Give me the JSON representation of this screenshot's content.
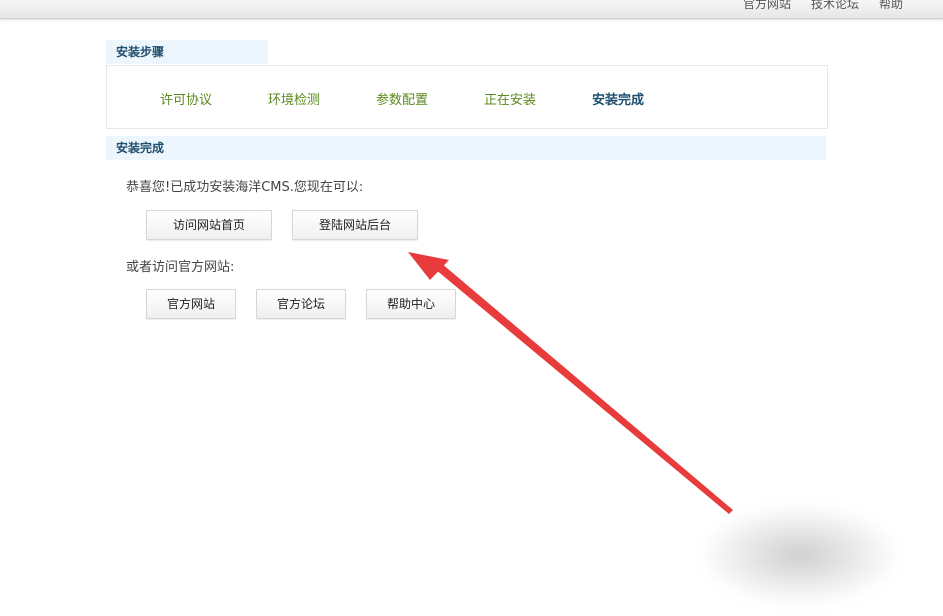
{
  "top_links": [
    "官方网站",
    "技术论坛",
    "帮助"
  ],
  "install_steps": {
    "title": "安装步骤",
    "steps": [
      "许可协议",
      "环境检测",
      "参数配置",
      "正在安装",
      "安装完成"
    ],
    "current_index": 4
  },
  "complete_section": {
    "title": "安装完成",
    "message": "恭喜您!已成功安装海洋CMS.您现在可以:",
    "buttons": [
      "访问网站首页",
      "登陆网站后台"
    ],
    "alt_message": "或者访问官方网站:",
    "alt_buttons": [
      "官方网站",
      "官方论坛",
      "帮助中心"
    ]
  },
  "annotation": {
    "arrow_color": "#e83b3b"
  }
}
